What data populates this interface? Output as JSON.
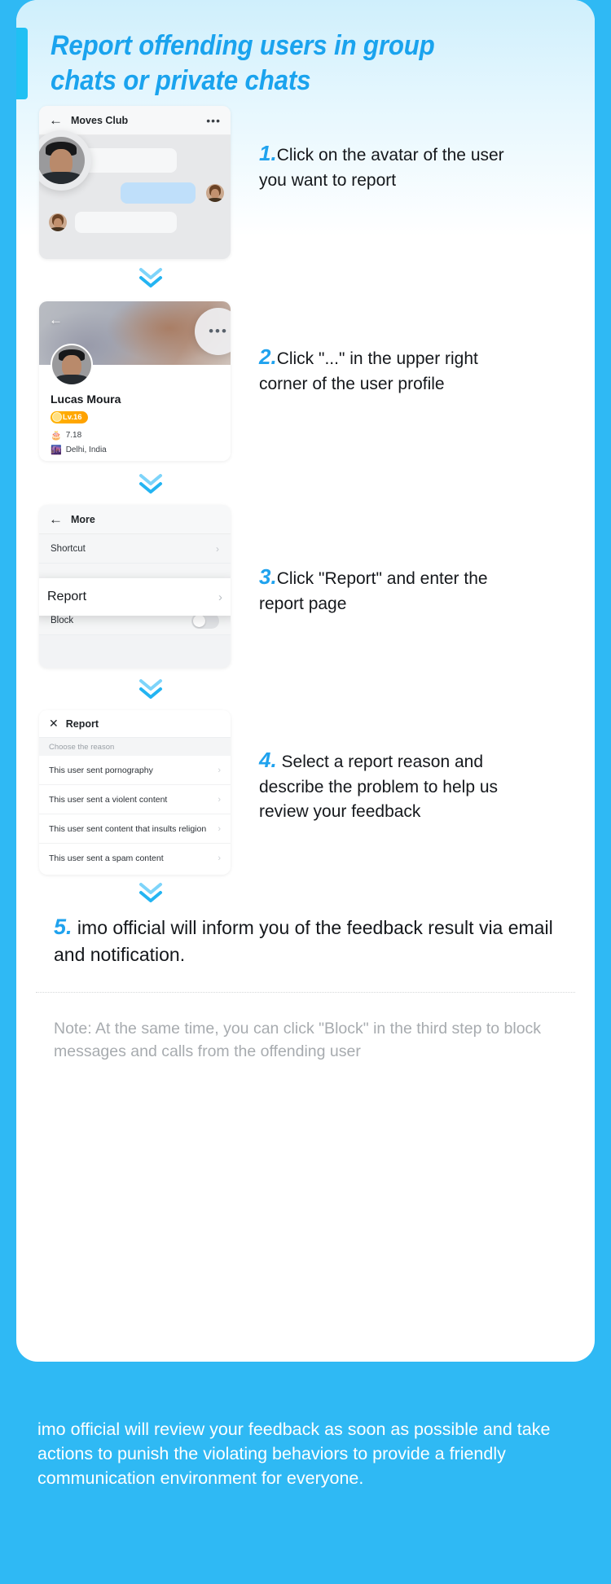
{
  "theme": {
    "brand_blue": "#2fb9f4",
    "title_blue": "#1aa3ee",
    "number_blue": "#1fa2ee",
    "badge_orange": "#ffa000",
    "note_gray": "#a7abaf"
  },
  "title": "Report offending users in group chats or private chats",
  "steps": [
    {
      "number": "1.",
      "text": "Click on the avatar of the user you want to report",
      "mock": {
        "type": "group-chat",
        "header_title": "Moves Club",
        "back_icon": "back-arrow-icon",
        "more_icon": "more-dots-icon"
      }
    },
    {
      "number": "2.",
      "text": "Click \"...\" in the upper right corner of the user profile",
      "mock": {
        "type": "user-profile",
        "back_icon": "back-arrow-icon",
        "more_icon": "more-dots-icon",
        "name": "Lucas Moura",
        "level_badge": "Lv.16",
        "birthday": "7.18",
        "birthday_icon": "birthday-cake-icon",
        "location": "Delhi, India",
        "location_icon": "city-icon"
      }
    },
    {
      "number": "3.",
      "text": "Click \"Report\" and enter the report page",
      "mock": {
        "type": "more-menu",
        "header_title": "More",
        "back_icon": "back-arrow-icon",
        "items": [
          {
            "label": "Shortcut",
            "control": "chevron"
          },
          {
            "label": "Report",
            "control": "chevron",
            "highlighted": true
          },
          {
            "label": "Block",
            "control": "toggle",
            "toggle_on": false
          }
        ]
      }
    },
    {
      "number": "4.",
      "text": " Select a report reason and describe the problem to help us review your feedback",
      "mock": {
        "type": "report-page",
        "header_title": "Report",
        "close_icon": "close-x-icon",
        "section_label": "Choose the reason",
        "reasons": [
          "This user sent pornography",
          "This user sent a violent content",
          "This user sent content that insults religion",
          "This user sent a spam content"
        ]
      }
    },
    {
      "number": "5.",
      "text": " imo official will inform you of the feedback result via email and notification."
    }
  ],
  "note": "Note: At the same time, you can click \"Block\" in the third step to block messages and calls from the offending user",
  "footer": "imo official will review your feedback as soon as possible and take actions to punish the violating behaviors to provide a friendly communication environment for everyone."
}
